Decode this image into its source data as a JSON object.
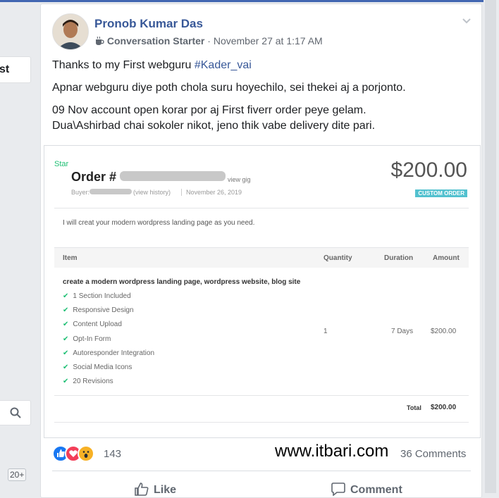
{
  "left_rail": {
    "tab_label": "st",
    "notif_badge": "20+"
  },
  "post": {
    "author": "Pronob Kumar Das",
    "badge_label": "Conversation Starter",
    "timestamp": "November 27 at 1:17 AM",
    "line1_prefix": "Thanks to my First webguru ",
    "hashtag": "#Kader_vai",
    "line2": "Apnar webguru diye poth chola suru hoyechilo, sei thekei aj a porjonto.",
    "line3a": "09 Nov account open korar por aj First fiverr order peye gelam.",
    "line3b": "Dua\\Ashirbad chai sokoler nikot, jeno thik vabe delivery dite pari."
  },
  "order": {
    "star": "Star",
    "order_label": "Order #",
    "view_gig": "view gig",
    "buyer_label": "Buyer:",
    "view_history": "(view history)",
    "date": "November 26, 2019",
    "price": "$200.00",
    "tag": "CUSTOM ORDER",
    "description": "I will creat your modern wordpress landing page as you need.",
    "columns": [
      "Item",
      "Quantity",
      "Duration",
      "Amount"
    ],
    "package": "create a modern wordpress landing page, wordpress website, blog site",
    "features": [
      "1 Section Included",
      "Responsive Design",
      "Content Upload",
      "Opt-In Form",
      "Autoresponder Integration",
      "Social Media Icons",
      "20 Revisions"
    ],
    "quantity": "1",
    "duration": "7 Days",
    "amount": "$200.00",
    "total_label": "Total",
    "total_value": "$200.00"
  },
  "footer": {
    "reaction_count": "143",
    "watermark": "www.itbari.com",
    "comments": "36 Comments",
    "like_label": "Like",
    "comment_label": "Comment"
  },
  "colors": {
    "facebook_blue": "#385898",
    "fiverr_green": "#1dbf73",
    "custom_tag": "#52c1cf"
  },
  "icons": [
    "search-icon",
    "coffee-icon",
    "chevron-down-icon",
    "like-reaction-icon",
    "love-reaction-icon",
    "wow-reaction-icon",
    "thumbs-up-icon",
    "comment-icon",
    "check-icon"
  ]
}
